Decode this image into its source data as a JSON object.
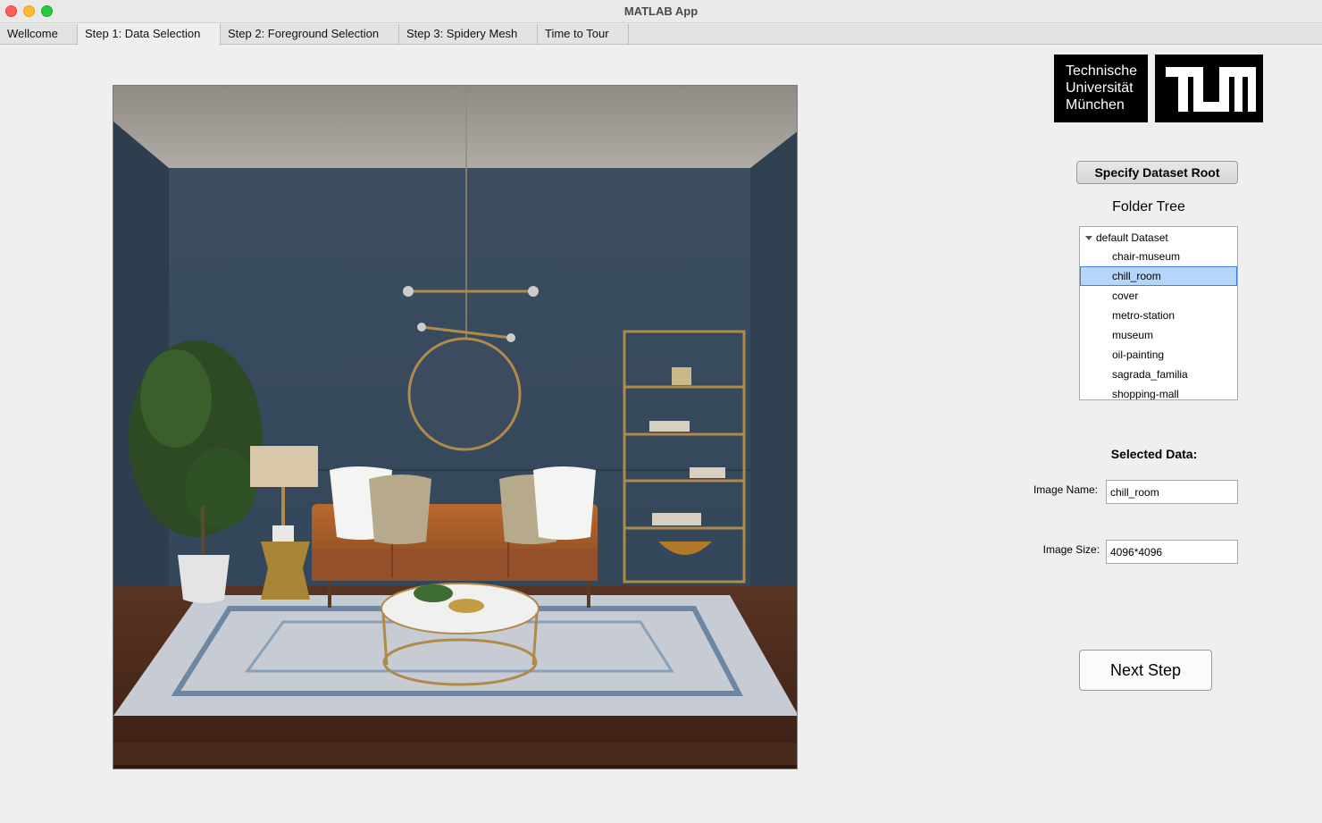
{
  "window": {
    "title": "MATLAB App"
  },
  "tabs": [
    {
      "label": "Wellcome"
    },
    {
      "label": "Step 1: Data Selection"
    },
    {
      "label": "Step 2: Foreground Selection"
    },
    {
      "label": "Step 3: Spidery Mesh"
    },
    {
      "label": "Time to Tour"
    }
  ],
  "logo": {
    "line1": "Technische",
    "line2": "Universität",
    "line3": "München"
  },
  "panel": {
    "dataset_button": "Specify Dataset Root",
    "folder_tree_title": "Folder Tree",
    "tree": {
      "root": "default Dataset",
      "items": [
        "chair-museum",
        "chill_room",
        "cover",
        "metro-station",
        "museum",
        "oil-painting",
        "sagrada_familia",
        "shopping-mall"
      ],
      "selected": "chill_room"
    },
    "selected_title": "Selected Data:",
    "image_name_label": "Image Name:",
    "image_name_value": "chill_room",
    "image_size_label": "Image Size:",
    "image_size_value": "4096*4096",
    "next_button": "Next Step"
  },
  "colors": {
    "selection": "#b5d5fb",
    "wall": "#3a4a5a",
    "sofa": "#a85d2e"
  }
}
